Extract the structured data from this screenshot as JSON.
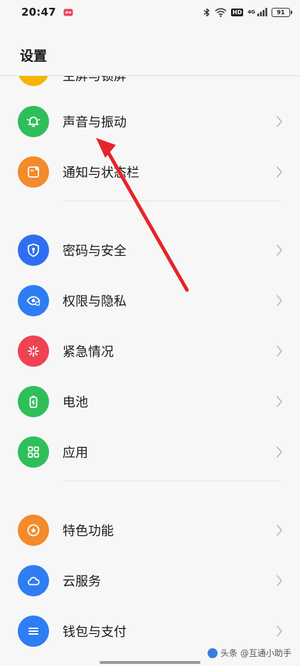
{
  "status_bar": {
    "time": "20:47",
    "hd_label": "HD",
    "network_label": "4G",
    "battery": "91"
  },
  "header": {
    "title": "设置"
  },
  "partial_item": {
    "label": "主屏与锁屏",
    "color": "#f5b400"
  },
  "groups": [
    [
      {
        "label": "声音与振动",
        "icon": "bell-icon",
        "color": "#2fbf5a"
      },
      {
        "label": "通知与状态栏",
        "icon": "notification-icon",
        "color": "#f38a2b"
      }
    ],
    [
      {
        "label": "密码与安全",
        "icon": "shield-icon",
        "color": "#2e6ff2"
      },
      {
        "label": "权限与隐私",
        "icon": "eye-icon",
        "color": "#2e7df2"
      },
      {
        "label": "紧急情况",
        "icon": "emergency-icon",
        "color": "#ee4452"
      },
      {
        "label": "电池",
        "icon": "battery-icon",
        "color": "#2fbf5a"
      },
      {
        "label": "应用",
        "icon": "grid-icon",
        "color": "#2fbf5a"
      }
    ],
    [
      {
        "label": "特色功能",
        "icon": "star-icon",
        "color": "#f38a2b"
      },
      {
        "label": "云服务",
        "icon": "cloud-icon",
        "color": "#2e7df2"
      },
      {
        "label": "钱包与支付",
        "icon": "wallet-icon",
        "color": "#2e7df2"
      }
    ]
  ],
  "watermark": {
    "text": "头条 @互通小助手"
  },
  "annotation": {
    "color": "#e5252a"
  }
}
